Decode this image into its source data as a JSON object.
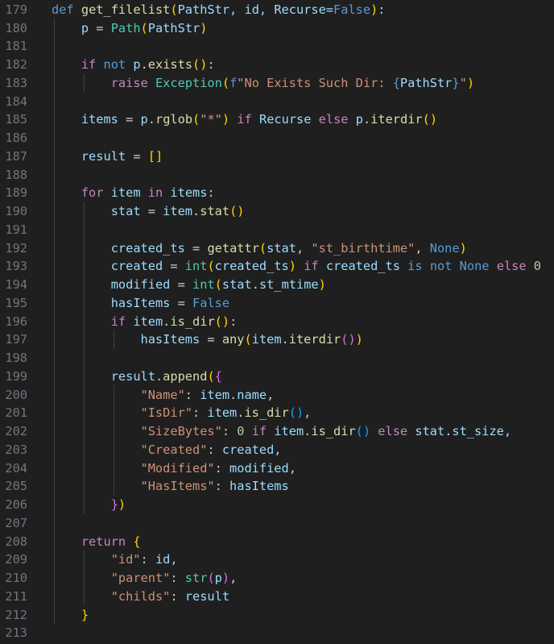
{
  "editor": {
    "theme": {
      "background": "#1f1f1f",
      "line_number": "#6e7681",
      "keyword": "#569cd6",
      "control": "#c586c0",
      "function": "#dcdcaa",
      "class": "#4ec9b0",
      "string": "#ce9178",
      "variable": "#9cdcfe",
      "number": "#b5cea8",
      "bracket_level_1": "#ffd700",
      "bracket_level_2": "#da70d6",
      "bracket_level_3": "#179fff"
    },
    "lines": [
      {
        "n": "179",
        "indent": 0,
        "tokens": [
          [
            "def",
            "keyword"
          ],
          [
            " ",
            "plain"
          ],
          [
            "get_filelist",
            "func"
          ],
          [
            "(",
            "brace"
          ],
          [
            "PathStr, id, Recurse=",
            "var"
          ],
          [
            "False",
            "keyword"
          ],
          [
            ")",
            "brace"
          ],
          [
            ":",
            "plain"
          ]
        ]
      },
      {
        "n": "180",
        "indent": 1,
        "tokens": [
          [
            "p",
            "var"
          ],
          [
            " = ",
            "plain"
          ],
          [
            "Path",
            "class"
          ],
          [
            "(",
            "brace"
          ],
          [
            "PathStr",
            "var"
          ],
          [
            ")",
            "brace"
          ]
        ]
      },
      {
        "n": "181",
        "indent": 1,
        "tokens": []
      },
      {
        "n": "182",
        "indent": 1,
        "tokens": [
          [
            "if",
            "control"
          ],
          [
            " ",
            "plain"
          ],
          [
            "not",
            "keyword"
          ],
          [
            " ",
            "plain"
          ],
          [
            "p",
            "var"
          ],
          [
            ".",
            "plain"
          ],
          [
            "exists",
            "func"
          ],
          [
            "()",
            "brace"
          ],
          [
            ":",
            "plain"
          ]
        ]
      },
      {
        "n": "183",
        "indent": 2,
        "tokens": [
          [
            "raise",
            "control"
          ],
          [
            " ",
            "plain"
          ],
          [
            "Exception",
            "class"
          ],
          [
            "(",
            "brace"
          ],
          [
            "f",
            "keyword"
          ],
          [
            "\"No Exists Such Dir: ",
            "string"
          ],
          [
            "{",
            "keyword"
          ],
          [
            "PathStr",
            "var"
          ],
          [
            "}",
            "keyword"
          ],
          [
            "\"",
            "string"
          ],
          [
            ")",
            "brace"
          ]
        ]
      },
      {
        "n": "184",
        "indent": 1,
        "tokens": []
      },
      {
        "n": "185",
        "indent": 1,
        "tokens": [
          [
            "items",
            "var"
          ],
          [
            " = ",
            "plain"
          ],
          [
            "p",
            "var"
          ],
          [
            ".",
            "plain"
          ],
          [
            "rglob",
            "func"
          ],
          [
            "(",
            "brace"
          ],
          [
            "\"*\"",
            "string"
          ],
          [
            ")",
            "brace"
          ],
          [
            " ",
            "plain"
          ],
          [
            "if",
            "control"
          ],
          [
            " ",
            "plain"
          ],
          [
            "Recurse",
            "var"
          ],
          [
            " ",
            "plain"
          ],
          [
            "else",
            "control"
          ],
          [
            " ",
            "plain"
          ],
          [
            "p",
            "var"
          ],
          [
            ".",
            "plain"
          ],
          [
            "iterdir",
            "func"
          ],
          [
            "()",
            "brace"
          ]
        ]
      },
      {
        "n": "186",
        "indent": 1,
        "tokens": []
      },
      {
        "n": "187",
        "indent": 1,
        "tokens": [
          [
            "result",
            "var"
          ],
          [
            " = ",
            "plain"
          ],
          [
            "[]",
            "brace"
          ]
        ]
      },
      {
        "n": "188",
        "indent": 1,
        "tokens": []
      },
      {
        "n": "189",
        "indent": 1,
        "tokens": [
          [
            "for",
            "control"
          ],
          [
            " ",
            "plain"
          ],
          [
            "item",
            "var"
          ],
          [
            " ",
            "plain"
          ],
          [
            "in",
            "control"
          ],
          [
            " ",
            "plain"
          ],
          [
            "items",
            "var"
          ],
          [
            ":",
            "plain"
          ]
        ]
      },
      {
        "n": "190",
        "indent": 2,
        "tokens": [
          [
            "stat",
            "var"
          ],
          [
            " = ",
            "plain"
          ],
          [
            "item",
            "var"
          ],
          [
            ".",
            "plain"
          ],
          [
            "stat",
            "func"
          ],
          [
            "()",
            "brace"
          ]
        ]
      },
      {
        "n": "191",
        "indent": 2,
        "tokens": []
      },
      {
        "n": "192",
        "indent": 2,
        "tokens": [
          [
            "created_ts",
            "var"
          ],
          [
            " = ",
            "plain"
          ],
          [
            "getattr",
            "func"
          ],
          [
            "(",
            "brace"
          ],
          [
            "stat",
            "var"
          ],
          [
            ", ",
            "plain"
          ],
          [
            "\"st_birthtime\"",
            "string"
          ],
          [
            ", ",
            "plain"
          ],
          [
            "None",
            "keyword"
          ],
          [
            ")",
            "brace"
          ]
        ]
      },
      {
        "n": "193",
        "indent": 2,
        "tokens": [
          [
            "created",
            "var"
          ],
          [
            " = ",
            "plain"
          ],
          [
            "int",
            "class"
          ],
          [
            "(",
            "brace"
          ],
          [
            "created_ts",
            "var"
          ],
          [
            ")",
            "brace"
          ],
          [
            " ",
            "plain"
          ],
          [
            "if",
            "control"
          ],
          [
            " ",
            "plain"
          ],
          [
            "created_ts",
            "var"
          ],
          [
            " ",
            "plain"
          ],
          [
            "is",
            "keyword"
          ],
          [
            " ",
            "plain"
          ],
          [
            "not",
            "keyword"
          ],
          [
            " ",
            "plain"
          ],
          [
            "None",
            "keyword"
          ],
          [
            " ",
            "plain"
          ],
          [
            "else",
            "control"
          ],
          [
            " ",
            "plain"
          ],
          [
            "0",
            "number"
          ]
        ]
      },
      {
        "n": "194",
        "indent": 2,
        "tokens": [
          [
            "modified",
            "var"
          ],
          [
            " = ",
            "plain"
          ],
          [
            "int",
            "class"
          ],
          [
            "(",
            "brace"
          ],
          [
            "stat",
            "var"
          ],
          [
            ".",
            "plain"
          ],
          [
            "st_mtime",
            "var"
          ],
          [
            ")",
            "brace"
          ]
        ]
      },
      {
        "n": "195",
        "indent": 2,
        "tokens": [
          [
            "hasItems",
            "var"
          ],
          [
            " = ",
            "plain"
          ],
          [
            "False",
            "keyword"
          ]
        ]
      },
      {
        "n": "196",
        "indent": 2,
        "tokens": [
          [
            "if",
            "control"
          ],
          [
            " ",
            "plain"
          ],
          [
            "item",
            "var"
          ],
          [
            ".",
            "plain"
          ],
          [
            "is_dir",
            "func"
          ],
          [
            "()",
            "brace"
          ],
          [
            ":",
            "plain"
          ]
        ]
      },
      {
        "n": "197",
        "indent": 3,
        "tokens": [
          [
            "hasItems",
            "var"
          ],
          [
            " = ",
            "plain"
          ],
          [
            "any",
            "func"
          ],
          [
            "(",
            "brace"
          ],
          [
            "item",
            "var"
          ],
          [
            ".",
            "plain"
          ],
          [
            "iterdir",
            "func"
          ],
          [
            "()",
            "paren2"
          ],
          [
            ")",
            "brace"
          ]
        ]
      },
      {
        "n": "198",
        "indent": 2,
        "tokens": []
      },
      {
        "n": "199",
        "indent": 2,
        "tokens": [
          [
            "result",
            "var"
          ],
          [
            ".",
            "plain"
          ],
          [
            "append",
            "func"
          ],
          [
            "(",
            "brace"
          ],
          [
            "{",
            "paren2"
          ]
        ]
      },
      {
        "n": "200",
        "indent": 3,
        "tokens": [
          [
            "\"Name\"",
            "string"
          ],
          [
            ": ",
            "plain"
          ],
          [
            "item",
            "var"
          ],
          [
            ".",
            "plain"
          ],
          [
            "name",
            "var"
          ],
          [
            ",",
            "plain"
          ]
        ]
      },
      {
        "n": "201",
        "indent": 3,
        "tokens": [
          [
            "\"IsDir\"",
            "string"
          ],
          [
            ": ",
            "plain"
          ],
          [
            "item",
            "var"
          ],
          [
            ".",
            "plain"
          ],
          [
            "is_dir",
            "func"
          ],
          [
            "()",
            "bracket3"
          ],
          [
            ",",
            "plain"
          ]
        ]
      },
      {
        "n": "202",
        "indent": 3,
        "tokens": [
          [
            "\"SizeBytes\"",
            "string"
          ],
          [
            ": ",
            "plain"
          ],
          [
            "0",
            "number"
          ],
          [
            " ",
            "plain"
          ],
          [
            "if",
            "control"
          ],
          [
            " ",
            "plain"
          ],
          [
            "item",
            "var"
          ],
          [
            ".",
            "plain"
          ],
          [
            "is_dir",
            "func"
          ],
          [
            "()",
            "bracket3"
          ],
          [
            " ",
            "plain"
          ],
          [
            "else",
            "control"
          ],
          [
            " ",
            "plain"
          ],
          [
            "stat",
            "var"
          ],
          [
            ".",
            "plain"
          ],
          [
            "st_size",
            "var"
          ],
          [
            ",",
            "plain"
          ]
        ]
      },
      {
        "n": "203",
        "indent": 3,
        "tokens": [
          [
            "\"Created\"",
            "string"
          ],
          [
            ": ",
            "plain"
          ],
          [
            "created",
            "var"
          ],
          [
            ",",
            "plain"
          ]
        ]
      },
      {
        "n": "204",
        "indent": 3,
        "tokens": [
          [
            "\"Modified\"",
            "string"
          ],
          [
            ": ",
            "plain"
          ],
          [
            "modified",
            "var"
          ],
          [
            ",",
            "plain"
          ]
        ]
      },
      {
        "n": "205",
        "indent": 3,
        "tokens": [
          [
            "\"HasItems\"",
            "string"
          ],
          [
            ": ",
            "plain"
          ],
          [
            "hasItems",
            "var"
          ]
        ]
      },
      {
        "n": "206",
        "indent": 2,
        "tokens": [
          [
            "}",
            "paren2"
          ],
          [
            ")",
            "brace"
          ]
        ]
      },
      {
        "n": "207",
        "indent": 1,
        "tokens": []
      },
      {
        "n": "208",
        "indent": 1,
        "tokens": [
          [
            "return",
            "control"
          ],
          [
            " ",
            "plain"
          ],
          [
            "{",
            "brace"
          ]
        ]
      },
      {
        "n": "209",
        "indent": 2,
        "tokens": [
          [
            "\"id\"",
            "string"
          ],
          [
            ": ",
            "plain"
          ],
          [
            "id",
            "var"
          ],
          [
            ",",
            "plain"
          ]
        ]
      },
      {
        "n": "210",
        "indent": 2,
        "tokens": [
          [
            "\"parent\"",
            "string"
          ],
          [
            ": ",
            "plain"
          ],
          [
            "str",
            "class"
          ],
          [
            "(",
            "paren2"
          ],
          [
            "p",
            "var"
          ],
          [
            ")",
            "paren2"
          ],
          [
            ",",
            "plain"
          ]
        ]
      },
      {
        "n": "211",
        "indent": 2,
        "tokens": [
          [
            "\"childs\"",
            "string"
          ],
          [
            ": ",
            "plain"
          ],
          [
            "result",
            "var"
          ]
        ]
      },
      {
        "n": "212",
        "indent": 1,
        "tokens": [
          [
            "}",
            "brace"
          ]
        ]
      },
      {
        "n": "213",
        "indent": 0,
        "tokens": []
      }
    ]
  }
}
